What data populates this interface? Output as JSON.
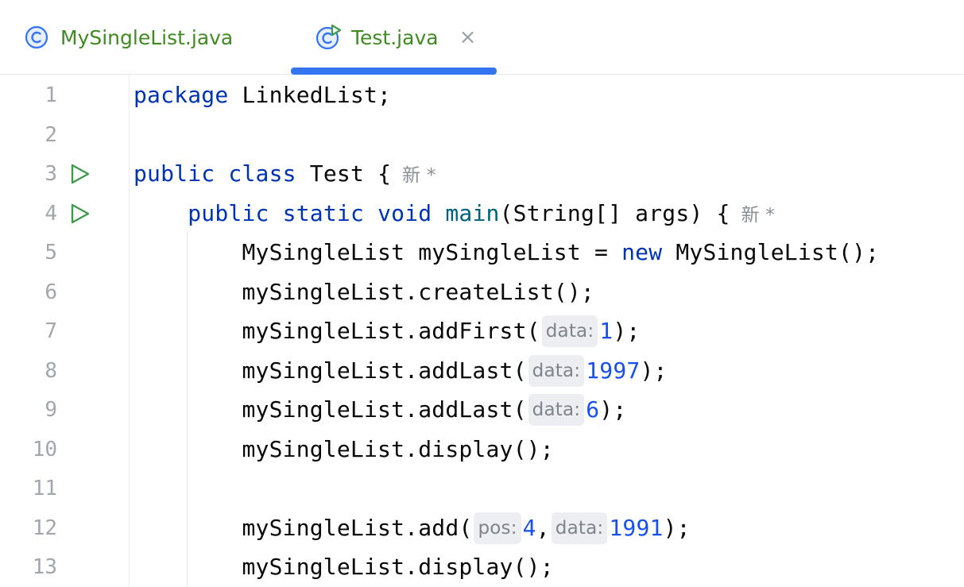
{
  "tabs": [
    {
      "label": "MySingleList.java",
      "icon": "class-icon",
      "active": false
    },
    {
      "label": "Test.java",
      "icon": "runnable-class-icon",
      "active": true,
      "close": "×"
    }
  ],
  "colors": {
    "accent": "#3574f0",
    "keyword": "#0033b3",
    "number": "#1750eb",
    "method": "#00627a",
    "tab_text": "#3f8b22",
    "run_icon": "#3f9b4b"
  },
  "editor": {
    "lines": [
      {
        "n": "1"
      },
      {
        "n": "2"
      },
      {
        "n": "3"
      },
      {
        "n": "4"
      },
      {
        "n": "5"
      },
      {
        "n": "6"
      },
      {
        "n": "7"
      },
      {
        "n": "8"
      },
      {
        "n": "9"
      },
      {
        "n": "10"
      },
      {
        "n": "11"
      },
      {
        "n": "12"
      },
      {
        "n": "13"
      }
    ],
    "tokens": {
      "l1_package": "package",
      "l1_rest": " LinkedList;",
      "l3_public": "public",
      "l3_class": "class",
      "l3_rest": " Test {",
      "l3_author": "新 *",
      "l4_indent": "    ",
      "l4_public": "public",
      "l4_static": "static",
      "l4_void": "void",
      "l4_main": "main",
      "l4_rest": "(String[] args) {",
      "l4_author": "新 *",
      "l5_a": "        MySingleList mySingleList = ",
      "l5_new": "new",
      "l5_b": " MySingleList();",
      "l6": "        mySingleList.createList();",
      "l7_a": "        mySingleList.addFirst(",
      "l7_hint": "data:",
      "l7_num": "1",
      "l7_b": ");",
      "l8_a": "        mySingleList.addLast(",
      "l8_hint": "data:",
      "l8_num": "1997",
      "l8_b": ");",
      "l9_a": "        mySingleList.addLast(",
      "l9_hint": "data:",
      "l9_num": "6",
      "l9_b": ");",
      "l10": "        mySingleList.display();",
      "l12_a": "        mySingleList.add(",
      "l12_hint1": "pos:",
      "l12_num1": "4",
      "l12_comma": ",",
      "l12_hint2": "data:",
      "l12_num2": "1991",
      "l12_b": ");",
      "l13": "        mySingleList.display();"
    }
  }
}
